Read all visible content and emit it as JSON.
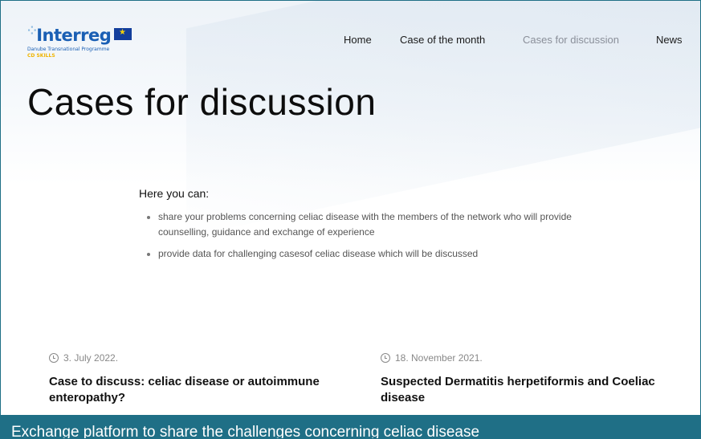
{
  "brand": {
    "name": "Interreg",
    "programme": "Danube Transnational Programme",
    "project": "CD SKILLS"
  },
  "nav": {
    "items": [
      {
        "label": "Home",
        "active": false
      },
      {
        "label": "Case of the month",
        "active": false
      },
      {
        "label": "Cases for discussion",
        "active": true
      },
      {
        "label": "News",
        "active": false
      }
    ]
  },
  "page": {
    "title": "Cases for discussion"
  },
  "intro": {
    "heading": "Here you can:",
    "bullets": [
      "share your problems concerning celiac disease with the members of the network who will provide counselling, guidance and exchange of experience",
      "provide data for challenging casesof celiac disease which will be discussed"
    ]
  },
  "posts": [
    {
      "date": "3. July 2022.",
      "title": "Case to discuss: celiac disease or autoimmune enteropathy?"
    },
    {
      "date": "18. November 2021.",
      "title": "Suspected Dermatitis herpetiformis and Coeliac disease"
    }
  ],
  "caption": "Exchange platform to share the challenges concerning celiac disease",
  "colors": {
    "accent": "#1f6f86",
    "brand_blue": "#1a5fb4",
    "muted_nav": "#8a8f99"
  }
}
